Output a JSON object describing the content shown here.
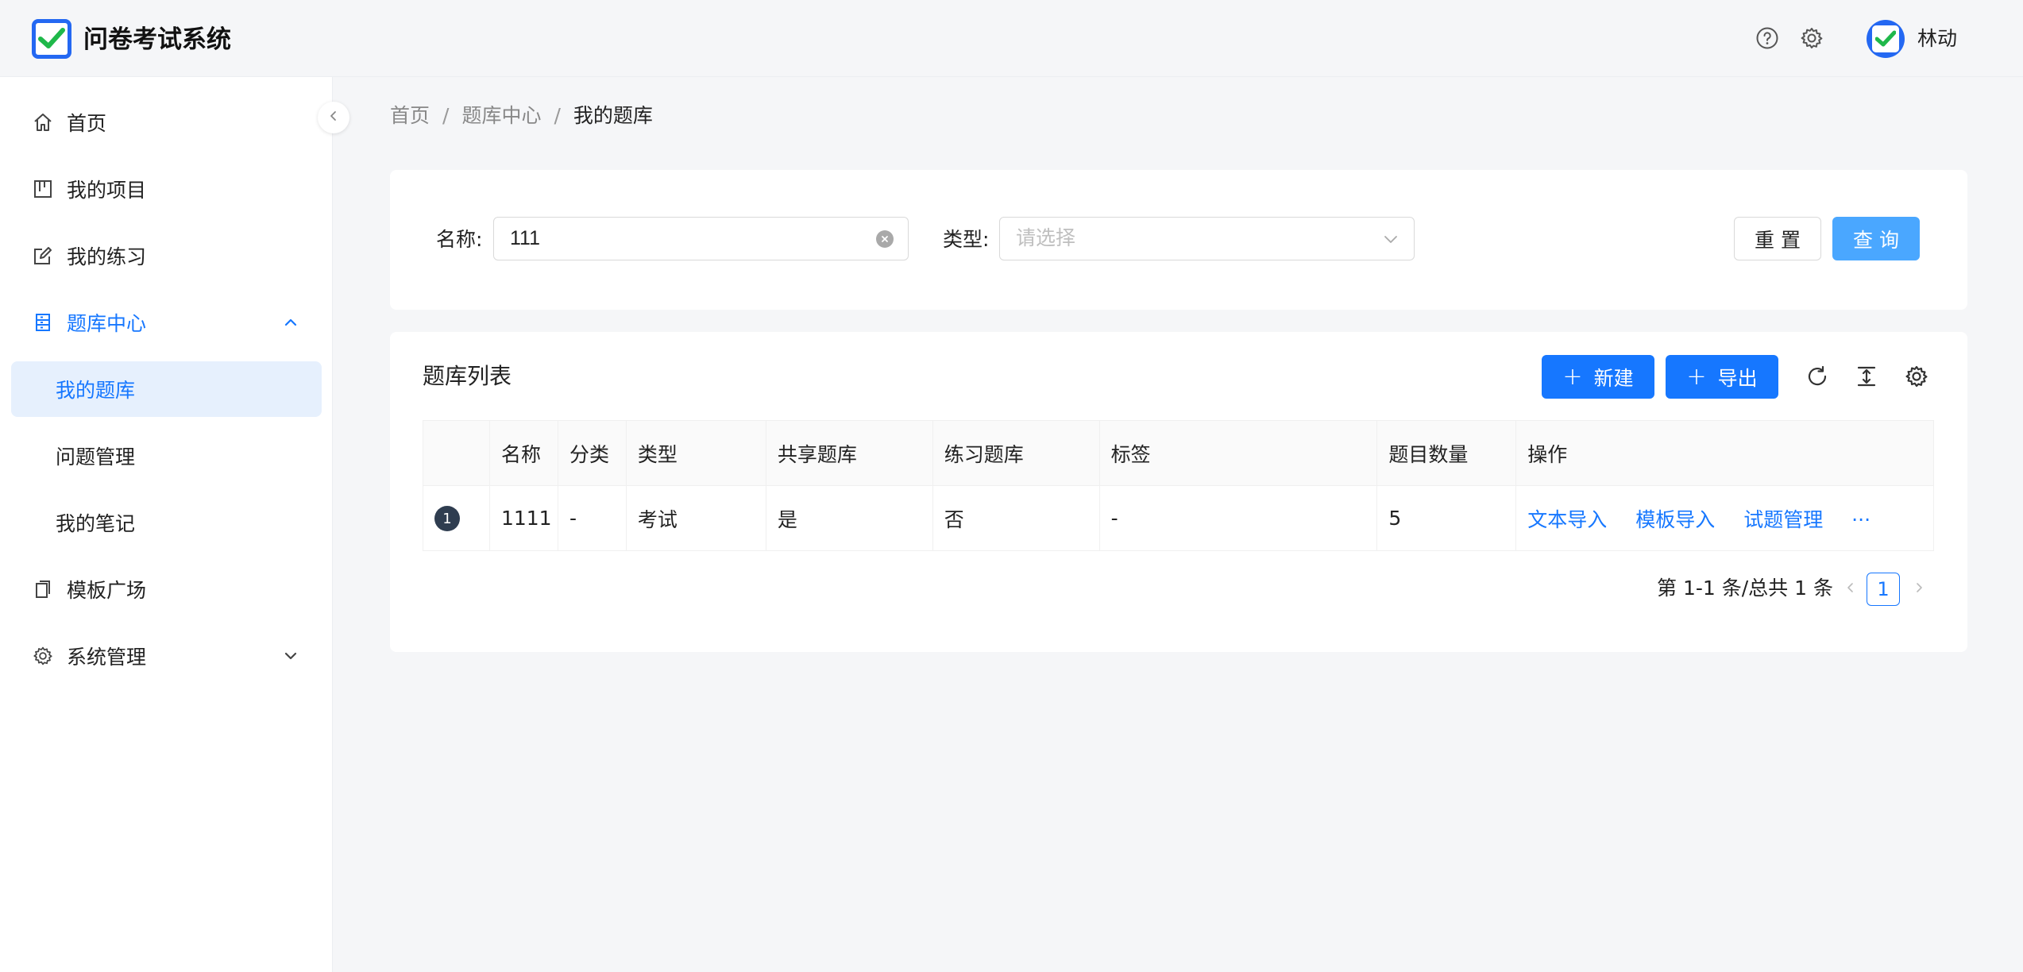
{
  "app": {
    "title": "问卷考试系统",
    "user_name": "林动",
    "accent": "#1677ff"
  },
  "header": {
    "icons": [
      "help-icon",
      "settings-icon"
    ]
  },
  "sidebar": {
    "items": [
      {
        "label": "首页",
        "icon": "home-icon"
      },
      {
        "label": "我的项目",
        "icon": "project-icon"
      },
      {
        "label": "我的练习",
        "icon": "edit-icon"
      },
      {
        "label": "题库中心",
        "icon": "database-icon",
        "expanded": true
      },
      {
        "label": "模板广场",
        "icon": "copy-icon"
      },
      {
        "label": "系统管理",
        "icon": "gear-icon",
        "expanded": false
      }
    ],
    "sub_items": [
      {
        "label": "我的题库",
        "selected": true
      },
      {
        "label": "问题管理"
      },
      {
        "label": "我的笔记"
      }
    ]
  },
  "breadcrumb": {
    "items": [
      "首页",
      "题库中心",
      "我的题库"
    ],
    "separator": "/"
  },
  "search": {
    "name_label": "名称:",
    "name_value": "111",
    "type_label": "类型:",
    "type_placeholder": "请选择",
    "reset_label": "重 置",
    "query_label": "查 询"
  },
  "table": {
    "title": "题库列表",
    "new_label": "新建",
    "export_label": "导出",
    "columns": [
      "",
      "名称",
      "分类",
      "类型",
      "共享题库",
      "练习题库",
      "标签",
      "题目数量",
      "操作"
    ],
    "rows": [
      {
        "index": "1",
        "name": "1111",
        "category": "-",
        "type": "考试",
        "shared": "是",
        "practice": "否",
        "tags": "-",
        "count": "5",
        "actions": [
          "文本导入",
          "模板导入",
          "试题管理",
          "···"
        ]
      }
    ]
  },
  "pagination": {
    "summary": "第 1-1 条/总共 1 条",
    "current_page": "1"
  }
}
